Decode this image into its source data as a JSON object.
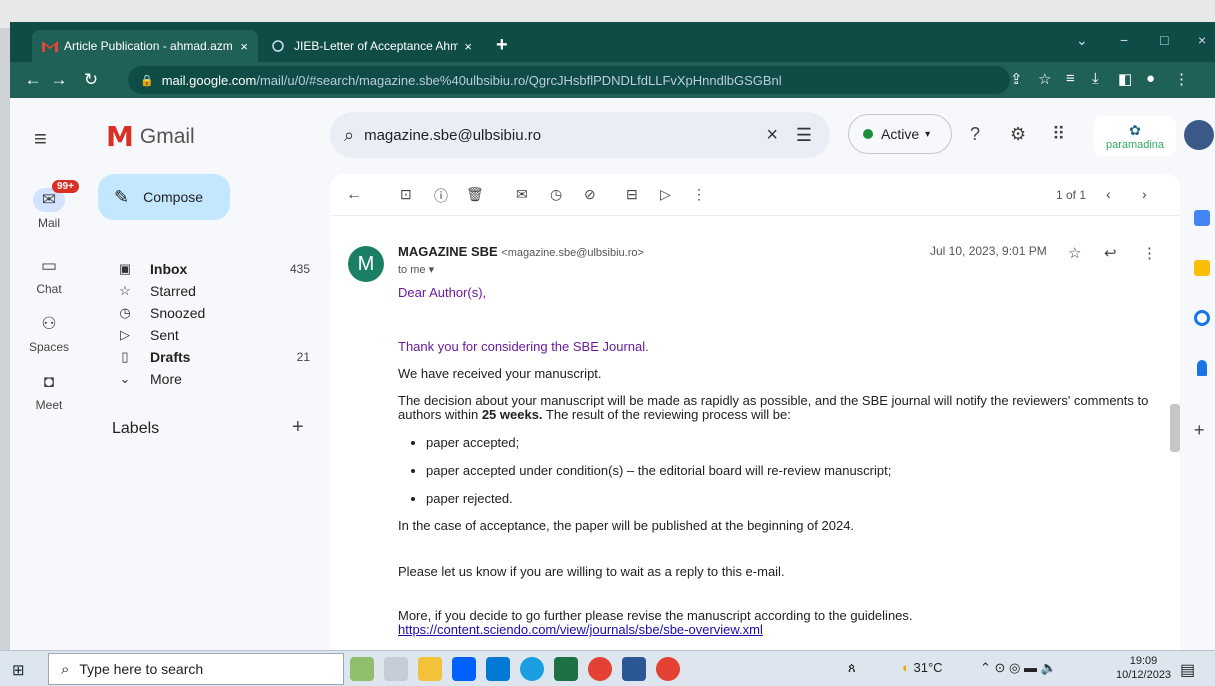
{
  "browser": {
    "tabs": [
      {
        "title": "Article Publication - ahmad.azm",
        "close": "×"
      },
      {
        "title": "JIEB-Letter of Acceptance Ahma",
        "close": "×"
      }
    ],
    "new_tab": "+",
    "url_host": "mail.google.com",
    "url_path": "/mail/u/0/#search/magazine.sbe%40ulbsibiu.ro/QgrcJHsbflPDNDLfdLLFvXpHnndlbGSGBnl",
    "window_controls": {
      "minimize": "−",
      "maximize": "□",
      "close": "×"
    }
  },
  "gmail": {
    "brand": "Gmail",
    "search_query": "magazine.sbe@ulbsibiu.ro",
    "status": "Active",
    "org_logo": "paramadina",
    "compose": "Compose",
    "rail": [
      {
        "label": "Mail",
        "badge": "99+"
      },
      {
        "label": "Chat"
      },
      {
        "label": "Spaces"
      },
      {
        "label": "Meet"
      }
    ],
    "nav": [
      {
        "label": "Inbox",
        "count": "435"
      },
      {
        "label": "Starred",
        "count": ""
      },
      {
        "label": "Snoozed",
        "count": ""
      },
      {
        "label": "Sent",
        "count": ""
      },
      {
        "label": "Drafts",
        "count": "21"
      },
      {
        "label": "More",
        "count": ""
      }
    ],
    "labels_heading": "Labels",
    "pager": "1 of 1"
  },
  "message": {
    "avatar_letter": "M",
    "sender_name": "MAGAZINE SBE",
    "sender_email": "<magazine.sbe@ulbsibiu.ro>",
    "to": "to me",
    "date": "Jul 10, 2023, 9:01 PM",
    "greeting": "Dear Author(s),",
    "thanks": "Thank you for considering the SBE Journal.",
    "received": "We have received your manuscript.",
    "decision_a": "The decision about your manuscript will be made as rapidly as possible, and the SBE journal will notify the reviewers' comments to authors within ",
    "decision_bold": "25 weeks.",
    "decision_b": " The result of the reviewing process will be:",
    "outcomes": [
      "paper accepted;",
      "paper accepted under condition(s) – the editorial board will re-review manuscript;",
      "paper rejected."
    ],
    "acceptance": "In the case of acceptance, the paper will be published at the beginning of 2024.",
    "wait": "Please let us know if you are willing to wait as a reply to this e-mail.",
    "revise": "More, if you decide to go further please revise the manuscript according to the guidelines. ",
    "link": "https://content.sciendo.com/view/journals/sbe/sbe-overview.xml"
  },
  "taskbar": {
    "search_placeholder": "Type here to search",
    "temperature": "31°C",
    "time": "19:09",
    "date": "10/12/2023"
  }
}
